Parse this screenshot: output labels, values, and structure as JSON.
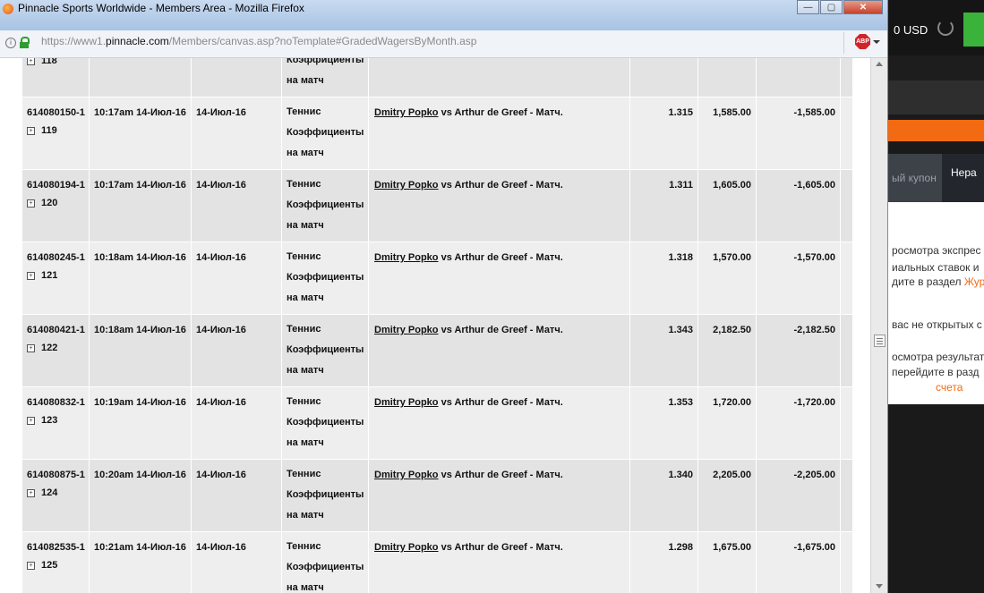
{
  "window": {
    "title": "Pinnacle Sports Worldwide - Members Area - Mozilla Firefox",
    "buttons": {
      "minimize": "—",
      "maximize": "▢",
      "close": "✕"
    }
  },
  "urlbar": {
    "prefix": "https://www1.",
    "domain": "pinnacle.com",
    "path": "/Members/canvas.asp?noTemplate#GradedWagersByMonth.asp",
    "abp_label": "ABP"
  },
  "background_app": {
    "balance": "0 USD",
    "tab_inactive": "ый купон",
    "tab_active": "Нера",
    "lines": [
      "росмотра экспрес",
      "иальных ставок и",
      "дите в раздел",
      "Жур",
      "вас не открытых с",
      "осмотра результат",
      "перейдите в разд",
      "счета"
    ]
  },
  "table": {
    "top_partial": {
      "num": "118",
      "sport_lines": [
        "Коэффициенты",
        "на матч"
      ]
    },
    "rows": [
      {
        "id": "614080150-1",
        "num": "119",
        "placed": "10:17am 14-Июл-16",
        "event_date": "14-Июл-16",
        "sport": "Теннис",
        "type1": "Коэффициенты",
        "type2": "на матч",
        "player": "Dmitry Popko",
        "rest": " vs Arthur de Greef - Матч.",
        "odds": "1.315",
        "stake": "1,585.00",
        "result": "-1,585.00"
      },
      {
        "id": "614080194-1",
        "num": "120",
        "placed": "10:17am 14-Июл-16",
        "event_date": "14-Июл-16",
        "sport": "Теннис",
        "type1": "Коэффициенты",
        "type2": "на матч",
        "player": "Dmitry Popko",
        "rest": " vs Arthur de Greef - Матч.",
        "odds": "1.311",
        "stake": "1,605.00",
        "result": "-1,605.00"
      },
      {
        "id": "614080245-1",
        "num": "121",
        "placed": "10:18am 14-Июл-16",
        "event_date": "14-Июл-16",
        "sport": "Теннис",
        "type1": "Коэффициенты",
        "type2": "на матч",
        "player": "Dmitry Popko",
        "rest": " vs Arthur de Greef - Матч.",
        "odds": "1.318",
        "stake": "1,570.00",
        "result": "-1,570.00"
      },
      {
        "id": "614080421-1",
        "num": "122",
        "placed": "10:18am 14-Июл-16",
        "event_date": "14-Июл-16",
        "sport": "Теннис",
        "type1": "Коэффициенты",
        "type2": "на матч",
        "player": "Dmitry Popko",
        "rest": " vs Arthur de Greef - Матч.",
        "odds": "1.343",
        "stake": "2,182.50",
        "result": "-2,182.50"
      },
      {
        "id": "614080832-1",
        "num": "123",
        "placed": "10:19am 14-Июл-16",
        "event_date": "14-Июл-16",
        "sport": "Теннис",
        "type1": "Коэффициенты",
        "type2": "на матч",
        "player": "Dmitry Popko",
        "rest": " vs Arthur de Greef - Матч.",
        "odds": "1.353",
        "stake": "1,720.00",
        "result": "-1,720.00"
      },
      {
        "id": "614080875-1",
        "num": "124",
        "placed": "10:20am 14-Июл-16",
        "event_date": "14-Июл-16",
        "sport": "Теннис",
        "type1": "Коэффициенты",
        "type2": "на матч",
        "player": "Dmitry Popko",
        "rest": " vs Arthur de Greef - Матч.",
        "odds": "1.340",
        "stake": "2,205.00",
        "result": "-2,205.00"
      },
      {
        "id": "614082535-1",
        "num": "125",
        "placed": "10:21am 14-Июл-16",
        "event_date": "14-Июл-16",
        "sport": "Теннис",
        "type1": "Коэффициенты",
        "type2": "на матч",
        "player": "Dmitry Popko",
        "rest": " vs Arthur de Greef - Матч.",
        "odds": "1.298",
        "stake": "1,675.00",
        "result": "-1,675.00"
      }
    ]
  }
}
